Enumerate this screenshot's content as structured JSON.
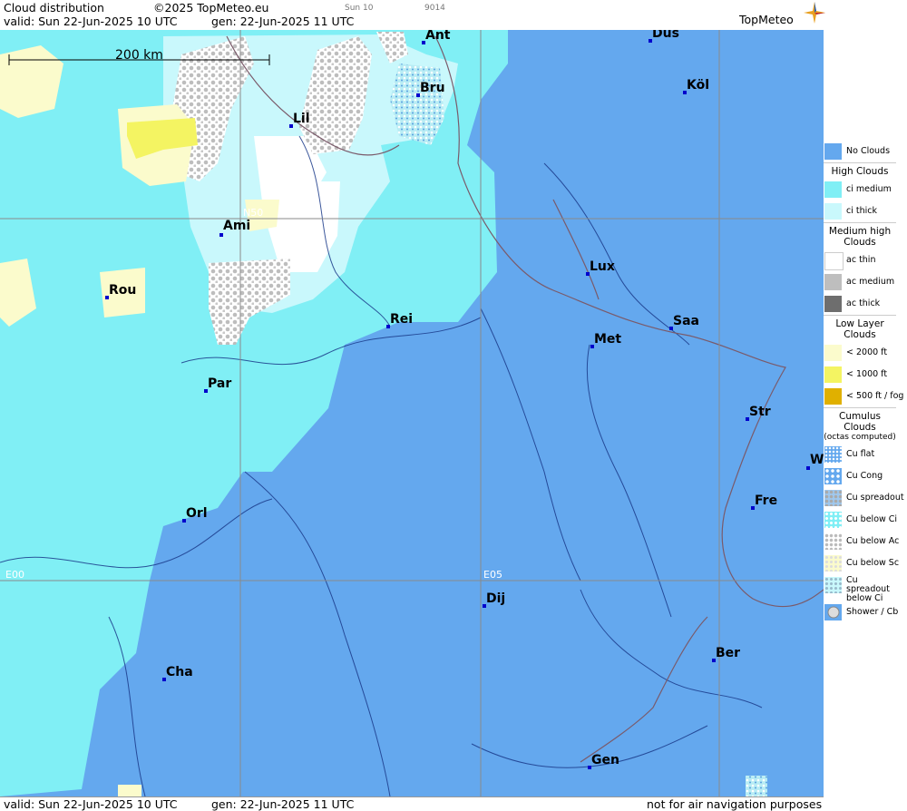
{
  "header": {
    "title": "Cloud distribution",
    "copyright": "©2025 TopMeteo.eu",
    "day_code": "Sun 10",
    "map_code": "9014",
    "valid": "valid:  Sun  22-Jun-2025  10 UTC",
    "generated": "gen: 22-Jun-2025 11 UTC",
    "logo": "TopMeteo"
  },
  "footer": {
    "valid": "valid:  Sun  22-Jun-2025  10 UTC",
    "generated": "gen: 22-Jun-2025 11 UTC",
    "disclaimer": "not for air navigation purposes"
  },
  "map": {
    "scale_label": "200 km",
    "grid_labels": {
      "n50": "N50",
      "e00": "E00",
      "e05": "E05"
    },
    "cities": [
      {
        "id": "ant",
        "label": "Ant"
      },
      {
        "id": "dus",
        "label": "Düs"
      },
      {
        "id": "bru",
        "label": "Bru"
      },
      {
        "id": "kol",
        "label": "Köl"
      },
      {
        "id": "lil",
        "label": "Lil"
      },
      {
        "id": "ami",
        "label": "Ami"
      },
      {
        "id": "rou",
        "label": "Rou"
      },
      {
        "id": "lux",
        "label": "Lux"
      },
      {
        "id": "rei",
        "label": "Rei"
      },
      {
        "id": "saa",
        "label": "Saa"
      },
      {
        "id": "met",
        "label": "Met"
      },
      {
        "id": "par",
        "label": "Par"
      },
      {
        "id": "str",
        "label": "Str"
      },
      {
        "id": "w",
        "label": "W"
      },
      {
        "id": "fre",
        "label": "Fre"
      },
      {
        "id": "orl",
        "label": "Orl"
      },
      {
        "id": "dij",
        "label": "Dij"
      },
      {
        "id": "ber",
        "label": "Ber"
      },
      {
        "id": "cha",
        "label": "Cha"
      },
      {
        "id": "gen",
        "label": "Gen"
      }
    ],
    "colors": {
      "no_clouds": "#64a8ee",
      "ci_medium": "#7ff0f6",
      "ci_thick": "#c8f8fb",
      "ac_thin": "#ffffff",
      "ac_medium": "#bebebe",
      "ac_thick": "#6e6e6e",
      "low_2000": "#fbfbcc",
      "low_1000": "#f4f462",
      "low_500": "#e0b000"
    }
  },
  "legend": {
    "no_clouds": "No Clouds",
    "high_title": "High Clouds",
    "ci_medium": "ci medium",
    "ci_thick": "ci thick",
    "medium_title": "Medium high Clouds",
    "ac_thin": "ac thin",
    "ac_medium": "ac medium",
    "ac_thick": "ac thick",
    "low_title": "Low Layer Clouds",
    "low_2000": "< 2000 ft",
    "low_1000": "< 1000 ft",
    "low_500": "< 500 ft / fog",
    "cu_title": "Cumulus Clouds",
    "cu_subtitle": "(octas computed)",
    "cu_flat": "Cu flat",
    "cu_cong": "Cu Cong",
    "cu_spread": "Cu spreadout",
    "cu_below_ci": "Cu below Ci",
    "cu_below_ac": "Cu below Ac",
    "cu_below_sc": "Cu below Sc",
    "cu_spread_ci": "Cu spreadout below Ci",
    "shower": "Shower / Cb"
  }
}
